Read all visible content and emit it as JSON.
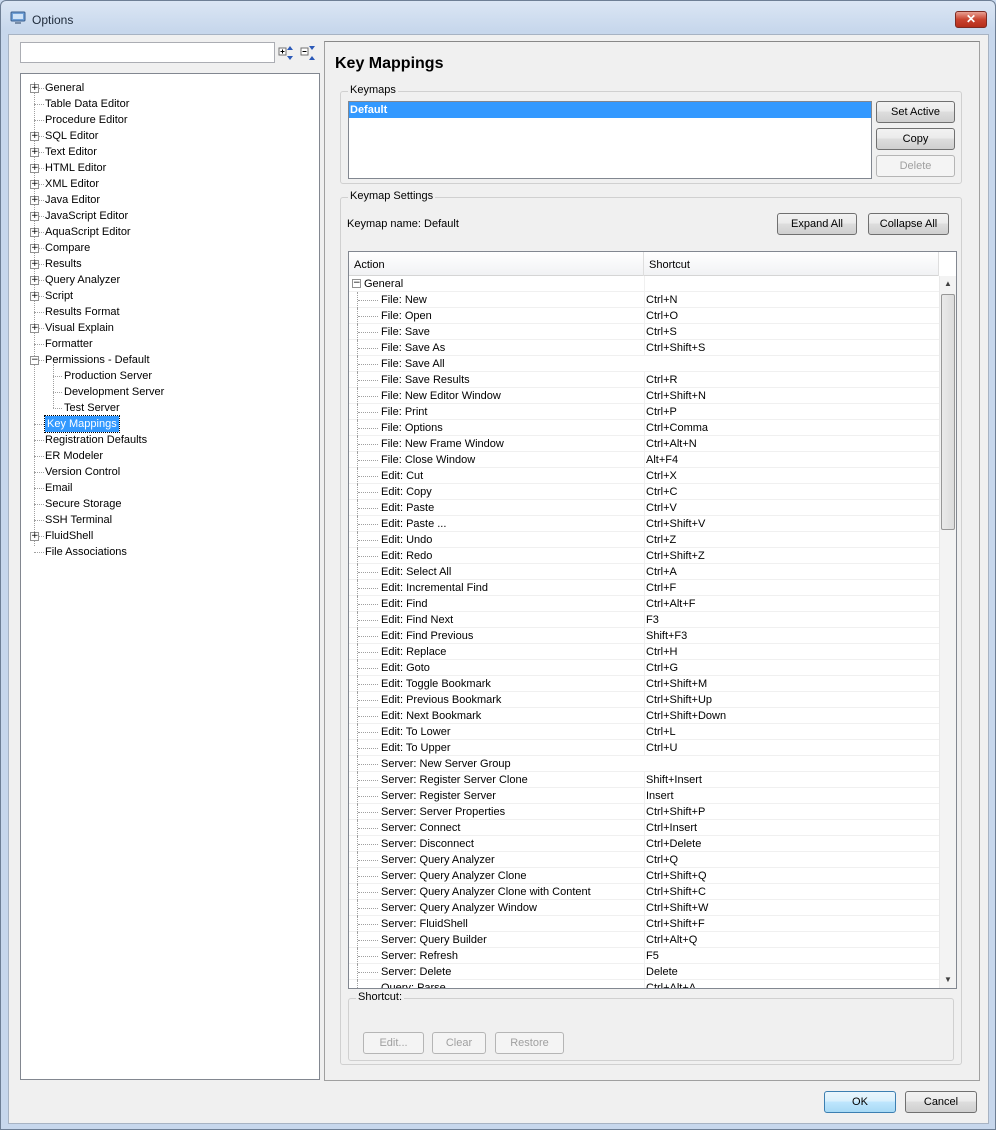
{
  "window": {
    "title": "Options",
    "close_label": "✕"
  },
  "tree": {
    "items": [
      {
        "label": "General",
        "level": 0,
        "expander": "+",
        "line": true
      },
      {
        "label": "Table Data Editor",
        "level": 0,
        "expander": "",
        "line": true
      },
      {
        "label": "Procedure Editor",
        "level": 0,
        "expander": "",
        "line": true
      },
      {
        "label": "SQL Editor",
        "level": 0,
        "expander": "+",
        "line": true
      },
      {
        "label": "Text Editor",
        "level": 0,
        "expander": "+",
        "line": true
      },
      {
        "label": "HTML Editor",
        "level": 0,
        "expander": "+",
        "line": true
      },
      {
        "label": "XML Editor",
        "level": 0,
        "expander": "+",
        "line": true
      },
      {
        "label": "Java Editor",
        "level": 0,
        "expander": "+",
        "line": true
      },
      {
        "label": "JavaScript Editor",
        "level": 0,
        "expander": "+",
        "line": true
      },
      {
        "label": "AquaScript Editor",
        "level": 0,
        "expander": "+",
        "line": true
      },
      {
        "label": "Compare",
        "level": 0,
        "expander": "+",
        "line": true
      },
      {
        "label": "Results",
        "level": 0,
        "expander": "+",
        "line": true
      },
      {
        "label": "Query Analyzer",
        "level": 0,
        "expander": "+",
        "line": true
      },
      {
        "label": "Script",
        "level": 0,
        "expander": "+",
        "line": true
      },
      {
        "label": "Results Format",
        "level": 0,
        "expander": "",
        "line": true
      },
      {
        "label": "Visual Explain",
        "level": 0,
        "expander": "+",
        "line": true
      },
      {
        "label": "Formatter",
        "level": 0,
        "expander": "",
        "line": true
      },
      {
        "label": "Permissions - Default",
        "level": 0,
        "expander": "−",
        "line": true
      },
      {
        "label": "Production Server",
        "level": 1,
        "expander": "",
        "line": true
      },
      {
        "label": "Development Server",
        "level": 1,
        "expander": "",
        "line": true
      },
      {
        "label": "Test Server",
        "level": 1,
        "expander": "",
        "line": true
      },
      {
        "label": "Key Mappings",
        "level": 0,
        "expander": "",
        "line": true,
        "selected": true
      },
      {
        "label": "Registration Defaults",
        "level": 0,
        "expander": "",
        "line": true
      },
      {
        "label": "ER Modeler",
        "level": 0,
        "expander": "",
        "line": true
      },
      {
        "label": "Version Control",
        "level": 0,
        "expander": "",
        "line": true
      },
      {
        "label": "Email",
        "level": 0,
        "expander": "",
        "line": true
      },
      {
        "label": "Secure Storage",
        "level": 0,
        "expander": "",
        "line": true
      },
      {
        "label": "SSH Terminal",
        "level": 0,
        "expander": "",
        "line": true
      },
      {
        "label": "FluidShell",
        "level": 0,
        "expander": "+",
        "line": true
      },
      {
        "label": "File Associations",
        "level": 0,
        "expander": "",
        "line": true
      }
    ]
  },
  "panel": {
    "heading": "Key Mappings",
    "keymaps_label": "Keymaps",
    "keymaps": [
      "Default"
    ],
    "set_active": "Set Active",
    "copy": "Copy",
    "delete": "Delete",
    "settings_label": "Keymap Settings",
    "keymap_name": "Keymap name: Default",
    "expand_all": "Expand All",
    "collapse_all": "Collapse All",
    "col_action": "Action",
    "col_shortcut": "Shortcut",
    "group_name": "General",
    "shortcut_label": "Shortcut:",
    "edit": "Edit...",
    "clear": "Clear",
    "restore": "Restore"
  },
  "mappings": [
    [
      "File: New",
      "Ctrl+N"
    ],
    [
      "File: Open",
      "Ctrl+O"
    ],
    [
      "File: Save",
      "Ctrl+S"
    ],
    [
      "File: Save As",
      "Ctrl+Shift+S"
    ],
    [
      "File: Save All",
      ""
    ],
    [
      "File: Save Results",
      "Ctrl+R"
    ],
    [
      "File: New Editor Window",
      "Ctrl+Shift+N"
    ],
    [
      "File: Print",
      "Ctrl+P"
    ],
    [
      "File: Options",
      "Ctrl+Comma"
    ],
    [
      "File: New Frame Window",
      "Ctrl+Alt+N"
    ],
    [
      "File: Close Window",
      "Alt+F4"
    ],
    [
      "Edit: Cut",
      "Ctrl+X"
    ],
    [
      "Edit: Copy",
      "Ctrl+C"
    ],
    [
      "Edit: Paste",
      "Ctrl+V"
    ],
    [
      "Edit: Paste ...",
      "Ctrl+Shift+V"
    ],
    [
      "Edit: Undo",
      "Ctrl+Z"
    ],
    [
      "Edit: Redo",
      "Ctrl+Shift+Z"
    ],
    [
      "Edit: Select All",
      "Ctrl+A"
    ],
    [
      "Edit: Incremental Find",
      "Ctrl+F"
    ],
    [
      "Edit: Find",
      "Ctrl+Alt+F"
    ],
    [
      "Edit: Find Next",
      "F3"
    ],
    [
      "Edit: Find Previous",
      "Shift+F3"
    ],
    [
      "Edit: Replace",
      "Ctrl+H"
    ],
    [
      "Edit: Goto",
      "Ctrl+G"
    ],
    [
      "Edit: Toggle Bookmark",
      "Ctrl+Shift+M"
    ],
    [
      "Edit: Previous Bookmark",
      "Ctrl+Shift+Up"
    ],
    [
      "Edit: Next Bookmark",
      "Ctrl+Shift+Down"
    ],
    [
      "Edit: To Lower",
      "Ctrl+L"
    ],
    [
      "Edit: To Upper",
      "Ctrl+U"
    ],
    [
      "Server: New Server Group",
      ""
    ],
    [
      "Server: Register Server Clone",
      "Shift+Insert"
    ],
    [
      "Server: Register Server",
      "Insert"
    ],
    [
      "Server: Server Properties",
      "Ctrl+Shift+P"
    ],
    [
      "Server: Connect",
      "Ctrl+Insert"
    ],
    [
      "Server: Disconnect",
      "Ctrl+Delete"
    ],
    [
      "Server: Query Analyzer",
      "Ctrl+Q"
    ],
    [
      "Server: Query Analyzer Clone",
      "Ctrl+Shift+Q"
    ],
    [
      "Server: Query Analyzer Clone with Content",
      "Ctrl+Shift+C"
    ],
    [
      "Server: Query Analyzer Window",
      "Ctrl+Shift+W"
    ],
    [
      "Server: FluidShell",
      "Ctrl+Shift+F"
    ],
    [
      "Server: Query Builder",
      "Ctrl+Alt+Q"
    ],
    [
      "Server: Refresh",
      "F5"
    ],
    [
      "Server: Delete",
      "Delete"
    ],
    [
      "Query: Parse",
      "Ctrl+Alt+A"
    ]
  ],
  "footer": {
    "ok": "OK",
    "cancel": "Cancel"
  }
}
